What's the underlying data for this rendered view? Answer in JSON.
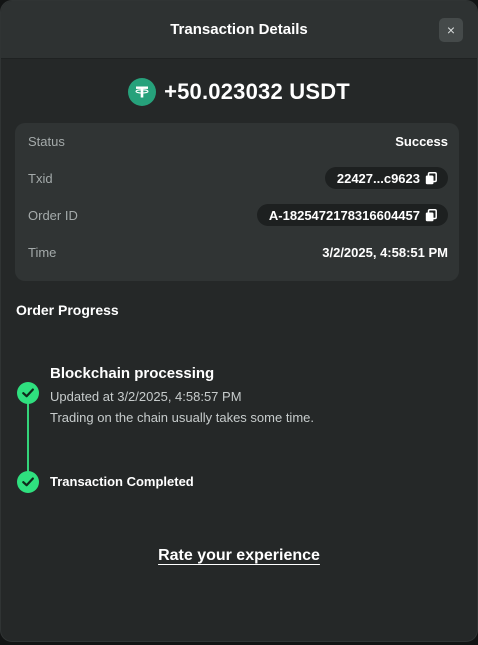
{
  "header": {
    "title": "Transaction Details",
    "close_label": "×"
  },
  "amount": {
    "text": "+50.023032 USDT",
    "coin_icon": "tether-icon",
    "coin_color": "#26a17b"
  },
  "details": {
    "status_label": "Status",
    "status_value": "Success",
    "txid_label": "Txid",
    "txid_value": "22427...c9623",
    "order_label": "Order ID",
    "order_value": "A-1825472178316604457",
    "time_label": "Time",
    "time_value": "3/2/2025, 4:58:51 PM"
  },
  "progress": {
    "title": "Order Progress",
    "accent": "#2fe07f",
    "steps": [
      {
        "title": "Blockchain processing",
        "updated": "Updated at 3/2/2025, 4:58:57 PM",
        "note": "Trading on the chain usually takes some time."
      },
      {
        "title": "Transaction Completed"
      }
    ]
  },
  "footer": {
    "rate_label": "Rate your experience"
  }
}
